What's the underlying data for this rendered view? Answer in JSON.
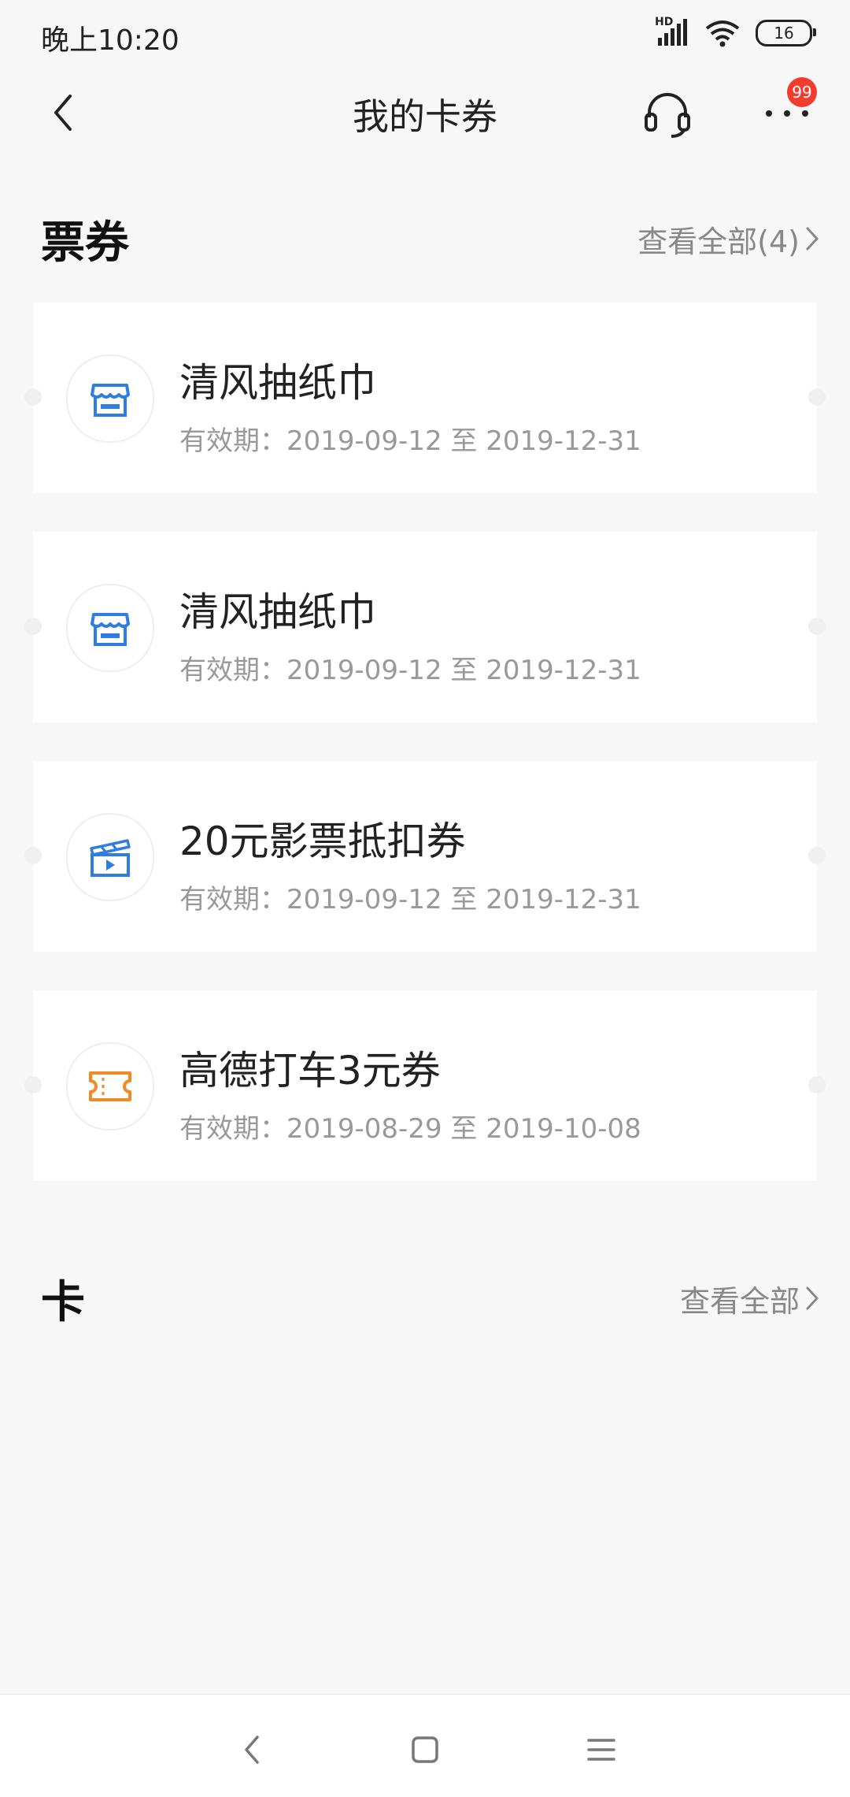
{
  "status_bar": {
    "time": "晚上10:20",
    "network_label": "HD",
    "battery_level": "16"
  },
  "header": {
    "title": "我的卡券",
    "badge_count": "99",
    "icons": [
      "back-arrow-icon",
      "headset-icon",
      "more-dots-icon"
    ]
  },
  "tickets_section": {
    "title": "票券",
    "view_all_label": "查看全部(4)",
    "items": [
      {
        "title": "清风抽纸巾",
        "validity": "有效期：2019-09-12 至 2019-12-31",
        "icon": "store-icon",
        "icon_color": "#2f7de1"
      },
      {
        "title": "清风抽纸巾",
        "validity": "有效期：2019-09-12 至 2019-12-31",
        "icon": "store-icon",
        "icon_color": "#2f7de1"
      },
      {
        "title": "20元影票抵扣券",
        "validity": "有效期：2019-09-12 至 2019-12-31",
        "icon": "movie-icon",
        "icon_color": "#2f7de1"
      },
      {
        "title": "高德打车3元券",
        "validity": "有效期：2019-08-29 至 2019-10-08",
        "icon": "ticket-icon",
        "icon_color": "#f08a24"
      }
    ]
  },
  "cards_section": {
    "title": "卡",
    "view_all_label": "查看全部"
  },
  "nav_bar": {
    "icons": [
      "nav-back-icon",
      "nav-home-icon",
      "nav-menu-icon"
    ]
  },
  "colors": {
    "background": "#f7f7f7",
    "card_bg": "#ffffff",
    "accent_blue": "#2f7de1",
    "accent_orange": "#f08a24",
    "badge_red": "#f23c2e"
  }
}
